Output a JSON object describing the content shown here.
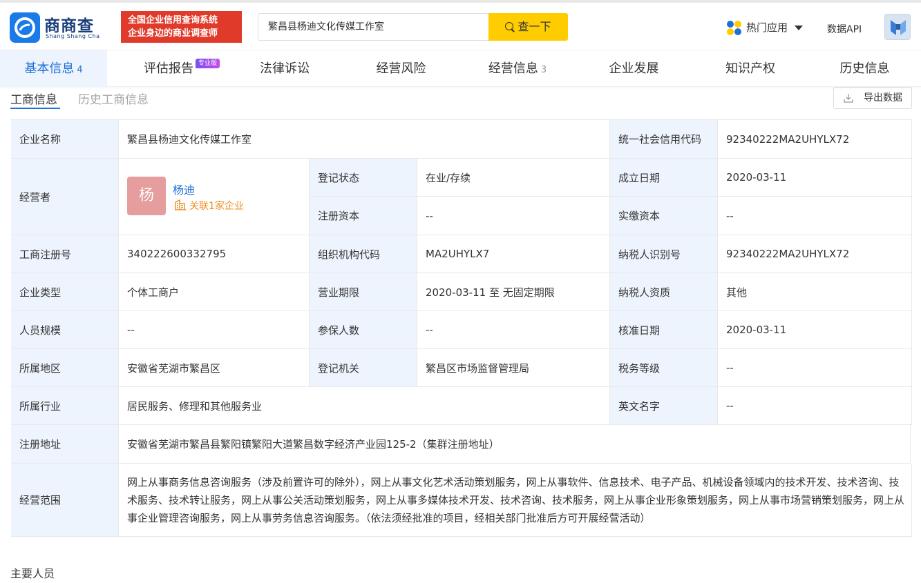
{
  "header": {
    "logo_text": "商商查",
    "logo_sub": "Shang Shang Cha",
    "banner_line1": "全国企业信用查询系统",
    "banner_line2": "企业身边的商业调查师",
    "search_value": "繁昌县杨迪文化传媒工作室",
    "search_button": "查一下",
    "hot_apps": "热门应用",
    "data_api": "数据API"
  },
  "tabs": [
    {
      "label": "基本信息",
      "count": "4"
    },
    {
      "label": "评估报告",
      "badge": "专业版"
    },
    {
      "label": "法律诉讼"
    },
    {
      "label": "经营风险"
    },
    {
      "label": "经营信息",
      "count": "3"
    },
    {
      "label": "企业发展"
    },
    {
      "label": "知识产权"
    },
    {
      "label": "历史信息"
    }
  ],
  "subtabs": {
    "active": "工商信息",
    "inactive": "历史工商信息"
  },
  "export_label": "导出数据",
  "info": {
    "company_name_label": "企业名称",
    "company_name": "繁昌县杨迪文化传媒工作室",
    "credit_code_label": "统一社会信用代码",
    "credit_code": "92340222MA2UHYLX72",
    "operator_label": "经营者",
    "operator_avatar": "杨",
    "operator_name": "杨迪",
    "operator_related": "关联1家企业",
    "reg_status_label": "登记状态",
    "reg_status": "在业/存续",
    "founded_label": "成立日期",
    "founded": "2020-03-11",
    "reg_capital_label": "注册资本",
    "reg_capital": "--",
    "paid_capital_label": "实缴资本",
    "paid_capital": "--",
    "reg_no_label": "工商注册号",
    "reg_no": "340222600332795",
    "org_code_label": "组织机构代码",
    "org_code": "MA2UHYLX7",
    "taxpayer_id_label": "纳税人识别号",
    "taxpayer_id": "92340222MA2UHYLX72",
    "type_label": "企业类型",
    "type": "个体工商户",
    "term_label": "营业期限",
    "term": "2020-03-11 至 无固定期限",
    "taxpayer_qual_label": "纳税人资质",
    "taxpayer_qual": "其他",
    "staff_label": "人员规模",
    "staff": "--",
    "insured_label": "参保人数",
    "insured": "--",
    "approved_label": "核准日期",
    "approved": "2020-03-11",
    "region_label": "所属地区",
    "region": "安徽省芜湖市繁昌区",
    "authority_label": "登记机关",
    "authority": "繁昌区市场监督管理局",
    "tax_grade_label": "税务等级",
    "tax_grade": "--",
    "industry_label": "所属行业",
    "industry": "居民服务、修理和其他服务业",
    "english_name_label": "英文名字",
    "english_name": "--",
    "address_label": "注册地址",
    "address": "安徽省芜湖市繁昌县繁阳镇繁阳大道繁昌数字经济产业园125-2（集群注册地址）",
    "scope_label": "经营范围",
    "scope": "网上从事商务信息咨询服务（涉及前置许可的除外），网上从事文化艺术活动策划服务，网上从事软件、信息技术、电子产品、机械设备领域内的技术开发、技术咨询、技术服务、技术转让服务，网上从事公关活动策划服务，网上从事多媒体技术开发、技术咨询、技术服务，网上从事企业形象策划服务，网上从事市场营销策划服务，网上从事企业管理咨询服务，网上从事劳务信息咨询服务。（依法须经批准的项目，经相关部门批准后方可开展经营活动）"
  },
  "section_title": "主要人员",
  "colors": {
    "accent": "#1e6fd9",
    "label_bg": "#eef4fd",
    "search_btn": "#ffcc00",
    "banner": "#e03a2b",
    "related": "#f08c1e"
  },
  "icons": [
    "logo-icon",
    "search-icon",
    "apps-icon",
    "caret-down-icon",
    "user-avatar-icon",
    "download-icon",
    "building-icon"
  ]
}
